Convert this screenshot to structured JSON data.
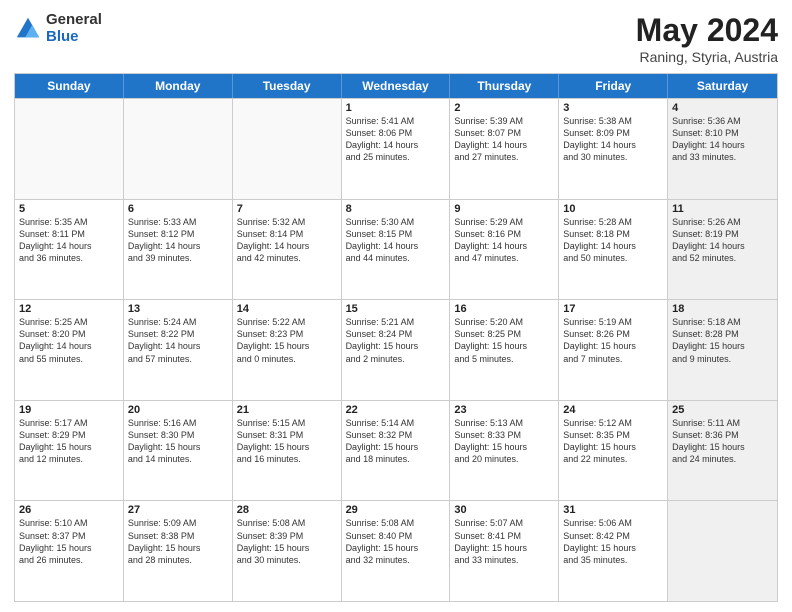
{
  "logo": {
    "general": "General",
    "blue": "Blue"
  },
  "header": {
    "title": "May 2024",
    "subtitle": "Raning, Styria, Austria"
  },
  "weekdays": [
    "Sunday",
    "Monday",
    "Tuesday",
    "Wednesday",
    "Thursday",
    "Friday",
    "Saturday"
  ],
  "weeks": [
    [
      {
        "day": "",
        "info": "",
        "empty": true
      },
      {
        "day": "",
        "info": "",
        "empty": true
      },
      {
        "day": "",
        "info": "",
        "empty": true
      },
      {
        "day": "1",
        "info": "Sunrise: 5:41 AM\nSunset: 8:06 PM\nDaylight: 14 hours\nand 25 minutes.",
        "empty": false
      },
      {
        "day": "2",
        "info": "Sunrise: 5:39 AM\nSunset: 8:07 PM\nDaylight: 14 hours\nand 27 minutes.",
        "empty": false
      },
      {
        "day": "3",
        "info": "Sunrise: 5:38 AM\nSunset: 8:09 PM\nDaylight: 14 hours\nand 30 minutes.",
        "empty": false
      },
      {
        "day": "4",
        "info": "Sunrise: 5:36 AM\nSunset: 8:10 PM\nDaylight: 14 hours\nand 33 minutes.",
        "empty": false,
        "shaded": true
      }
    ],
    [
      {
        "day": "5",
        "info": "Sunrise: 5:35 AM\nSunset: 8:11 PM\nDaylight: 14 hours\nand 36 minutes.",
        "empty": false
      },
      {
        "day": "6",
        "info": "Sunrise: 5:33 AM\nSunset: 8:12 PM\nDaylight: 14 hours\nand 39 minutes.",
        "empty": false
      },
      {
        "day": "7",
        "info": "Sunrise: 5:32 AM\nSunset: 8:14 PM\nDaylight: 14 hours\nand 42 minutes.",
        "empty": false
      },
      {
        "day": "8",
        "info": "Sunrise: 5:30 AM\nSunset: 8:15 PM\nDaylight: 14 hours\nand 44 minutes.",
        "empty": false
      },
      {
        "day": "9",
        "info": "Sunrise: 5:29 AM\nSunset: 8:16 PM\nDaylight: 14 hours\nand 47 minutes.",
        "empty": false
      },
      {
        "day": "10",
        "info": "Sunrise: 5:28 AM\nSunset: 8:18 PM\nDaylight: 14 hours\nand 50 minutes.",
        "empty": false
      },
      {
        "day": "11",
        "info": "Sunrise: 5:26 AM\nSunset: 8:19 PM\nDaylight: 14 hours\nand 52 minutes.",
        "empty": false,
        "shaded": true
      }
    ],
    [
      {
        "day": "12",
        "info": "Sunrise: 5:25 AM\nSunset: 8:20 PM\nDaylight: 14 hours\nand 55 minutes.",
        "empty": false
      },
      {
        "day": "13",
        "info": "Sunrise: 5:24 AM\nSunset: 8:22 PM\nDaylight: 14 hours\nand 57 minutes.",
        "empty": false
      },
      {
        "day": "14",
        "info": "Sunrise: 5:22 AM\nSunset: 8:23 PM\nDaylight: 15 hours\nand 0 minutes.",
        "empty": false
      },
      {
        "day": "15",
        "info": "Sunrise: 5:21 AM\nSunset: 8:24 PM\nDaylight: 15 hours\nand 2 minutes.",
        "empty": false
      },
      {
        "day": "16",
        "info": "Sunrise: 5:20 AM\nSunset: 8:25 PM\nDaylight: 15 hours\nand 5 minutes.",
        "empty": false
      },
      {
        "day": "17",
        "info": "Sunrise: 5:19 AM\nSunset: 8:26 PM\nDaylight: 15 hours\nand 7 minutes.",
        "empty": false
      },
      {
        "day": "18",
        "info": "Sunrise: 5:18 AM\nSunset: 8:28 PM\nDaylight: 15 hours\nand 9 minutes.",
        "empty": false,
        "shaded": true
      }
    ],
    [
      {
        "day": "19",
        "info": "Sunrise: 5:17 AM\nSunset: 8:29 PM\nDaylight: 15 hours\nand 12 minutes.",
        "empty": false
      },
      {
        "day": "20",
        "info": "Sunrise: 5:16 AM\nSunset: 8:30 PM\nDaylight: 15 hours\nand 14 minutes.",
        "empty": false
      },
      {
        "day": "21",
        "info": "Sunrise: 5:15 AM\nSunset: 8:31 PM\nDaylight: 15 hours\nand 16 minutes.",
        "empty": false
      },
      {
        "day": "22",
        "info": "Sunrise: 5:14 AM\nSunset: 8:32 PM\nDaylight: 15 hours\nand 18 minutes.",
        "empty": false
      },
      {
        "day": "23",
        "info": "Sunrise: 5:13 AM\nSunset: 8:33 PM\nDaylight: 15 hours\nand 20 minutes.",
        "empty": false
      },
      {
        "day": "24",
        "info": "Sunrise: 5:12 AM\nSunset: 8:35 PM\nDaylight: 15 hours\nand 22 minutes.",
        "empty": false
      },
      {
        "day": "25",
        "info": "Sunrise: 5:11 AM\nSunset: 8:36 PM\nDaylight: 15 hours\nand 24 minutes.",
        "empty": false,
        "shaded": true
      }
    ],
    [
      {
        "day": "26",
        "info": "Sunrise: 5:10 AM\nSunset: 8:37 PM\nDaylight: 15 hours\nand 26 minutes.",
        "empty": false
      },
      {
        "day": "27",
        "info": "Sunrise: 5:09 AM\nSunset: 8:38 PM\nDaylight: 15 hours\nand 28 minutes.",
        "empty": false
      },
      {
        "day": "28",
        "info": "Sunrise: 5:08 AM\nSunset: 8:39 PM\nDaylight: 15 hours\nand 30 minutes.",
        "empty": false
      },
      {
        "day": "29",
        "info": "Sunrise: 5:08 AM\nSunset: 8:40 PM\nDaylight: 15 hours\nand 32 minutes.",
        "empty": false
      },
      {
        "day": "30",
        "info": "Sunrise: 5:07 AM\nSunset: 8:41 PM\nDaylight: 15 hours\nand 33 minutes.",
        "empty": false
      },
      {
        "day": "31",
        "info": "Sunrise: 5:06 AM\nSunset: 8:42 PM\nDaylight: 15 hours\nand 35 minutes.",
        "empty": false
      },
      {
        "day": "",
        "info": "",
        "empty": true,
        "shaded": true
      }
    ]
  ]
}
